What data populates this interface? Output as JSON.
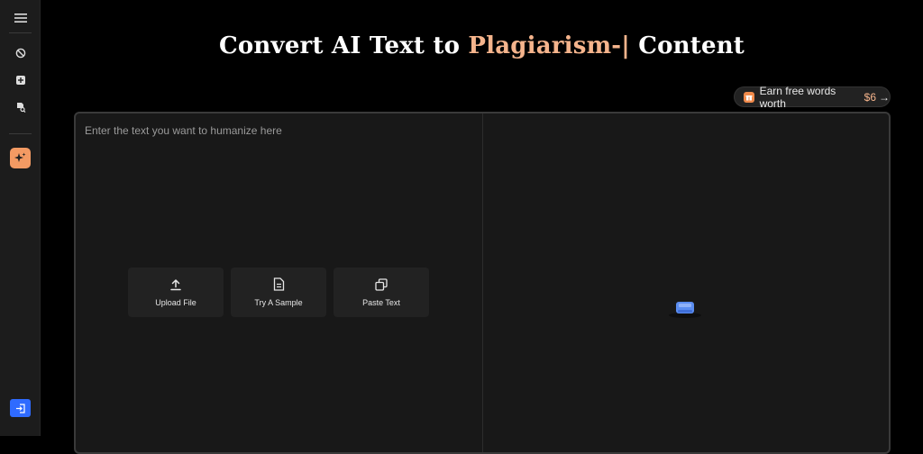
{
  "title": {
    "prefix": "Convert AI Text to ",
    "accent": "Plagiarism-|",
    "suffix": " Content"
  },
  "earn": {
    "label": "Earn free words worth",
    "amount": "$6",
    "arrow": "→"
  },
  "editor": {
    "placeholder": "Enter the text you want to humanize here"
  },
  "actions": [
    {
      "label": "Upload File",
      "icon": "upload-icon"
    },
    {
      "label": "Try A Sample",
      "icon": "document-icon"
    },
    {
      "label": "Paste Text",
      "icon": "copy-icon"
    }
  ],
  "colors": {
    "accent": "#f5b48c",
    "ai_button": "#f39a63",
    "login_button": "#2f6bff",
    "loader": "#5b8df0"
  },
  "sidebar_icons": [
    "menu-icon",
    "history-icon",
    "add-icon",
    "document-search-icon",
    "ai-sparkle-icon",
    "login-icon"
  ]
}
